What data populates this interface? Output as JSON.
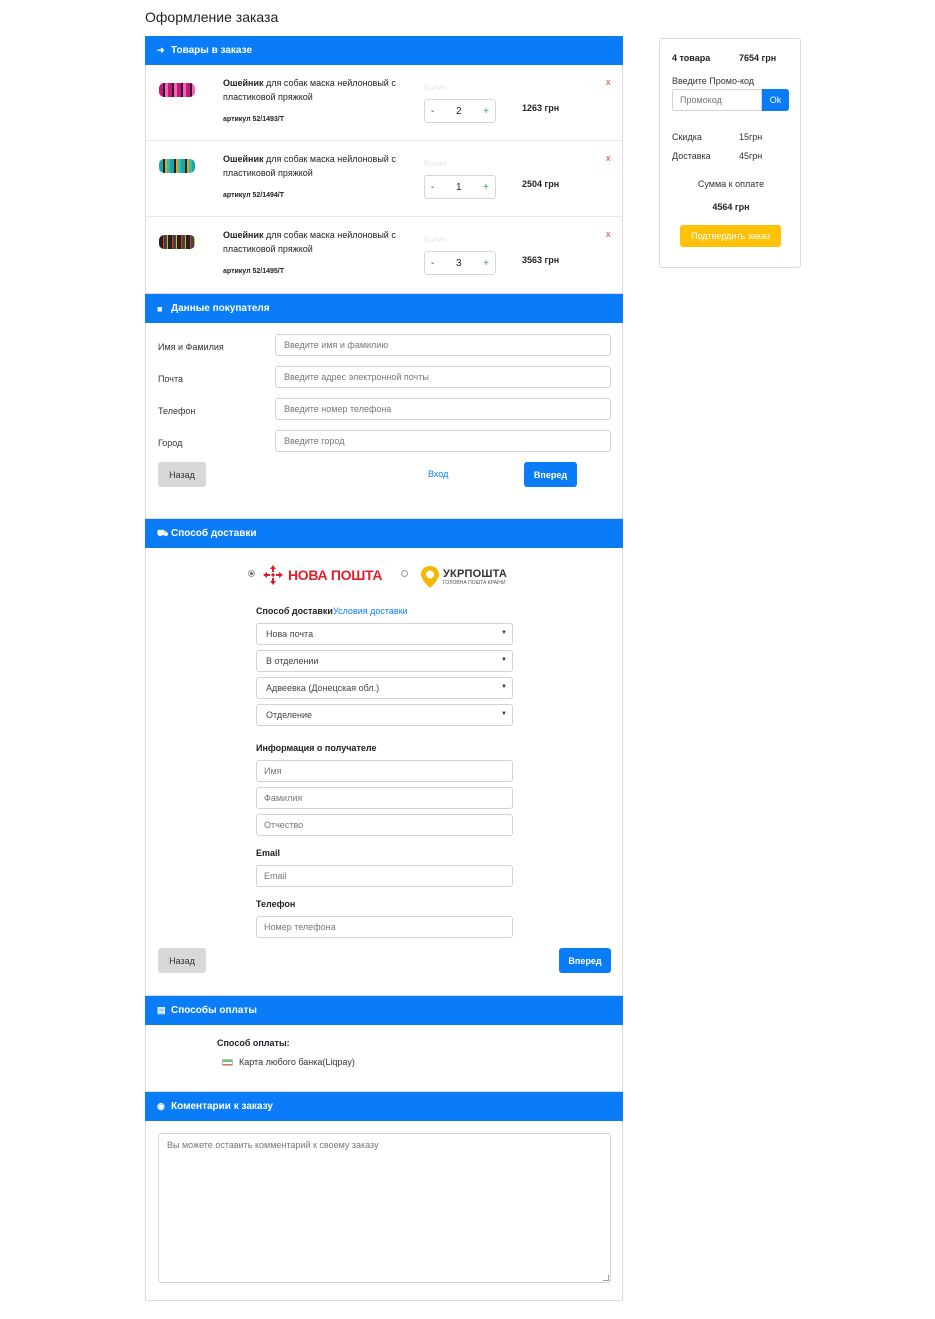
{
  "page": {
    "title": "Оформление заказа"
  },
  "colors": {
    "primary": "#0a7cf7",
    "accent": "#ffc107",
    "danger": "#e33333",
    "plus": "#28a745"
  },
  "cart": {
    "heading": "Товары в заказе",
    "heading_icon": "sign-in-icon",
    "qty_label": "Колич",
    "items": [
      {
        "name_bold": "Ошейник",
        "name_rest": " для собак маска нейлоновый с пластиковой пряжкой",
        "sku": "артикул 52/1493/Т",
        "qty": "2",
        "minus": "-",
        "plus": "+",
        "price": "1263 грн",
        "remove": "x"
      },
      {
        "name_bold": "Ошейник",
        "name_rest": " для собак маска нейлоновый с пластиковой пряжкой",
        "sku": "артикул 52/1494/Т",
        "qty": "1",
        "minus": "-",
        "plus": "+",
        "price": "2504 грн",
        "remove": "x"
      },
      {
        "name_bold": "Ошейник",
        "name_rest": " для собак маска нейлоновый с пластиковой пряжкой",
        "sku": "артикул 52/1495/Т",
        "qty": "3",
        "minus": "-",
        "plus": "+",
        "price": "3563 грн",
        "remove": "x"
      }
    ]
  },
  "buyer": {
    "heading": "Данные покупателя",
    "heading_icon": "id-card-icon",
    "fields": [
      {
        "label": "Имя и Фамилия",
        "placeholder": "Введите имя и фамилию"
      },
      {
        "label": "Почта",
        "placeholder": "Введите адрес электронной почты"
      },
      {
        "label": "Телефон",
        "placeholder": "Введите номер телефона"
      },
      {
        "label": "Город",
        "placeholder": "Введите город"
      }
    ],
    "back": "Назад",
    "login": "Вход",
    "next": "Вперед"
  },
  "delivery": {
    "heading": "Способ доставки",
    "heading_icon": "truck-icon",
    "np_logo": "НОВА ПОШТА",
    "up_logo": "УКРПОШТА",
    "up_tagline": "ГОЛОВНА ПОШТА КРАЇНИ",
    "method_label": "Способ доставки",
    "conditions_link": "Условия доставки",
    "selects": [
      "Нова почта",
      "В отделении",
      "Адвеевка (Донецская обл.)",
      "Отделение"
    ],
    "recipient_label": "Информация о получателе",
    "recipient_fields": [
      "Имя",
      "Фамилия",
      "Отчество"
    ],
    "email_label": "Email",
    "email_placeholder": "Email",
    "phone_label": "Телефон",
    "phone_placeholder": "Номер телефона",
    "back": "Назад",
    "next": "Вперед"
  },
  "payment": {
    "heading": "Способы оплаты",
    "heading_icon": "credit-card-icon",
    "label": "Способ оплаты:",
    "option": "Карта любого банка(Liqpay)"
  },
  "comments": {
    "heading": "Коментарии к заказу",
    "heading_icon": "comments-icon",
    "placeholder": "Вы можете оставить комментарий к своему заказу"
  },
  "summary": {
    "count": "4 товара",
    "total": "7654 грн",
    "promo_label": "Введите Промо-код",
    "promo_placeholder": "Промокод",
    "promo_button": "Ok",
    "discount_label": "Скидка",
    "discount_value": "15грн",
    "delivery_label": "Доставка",
    "delivery_value": "45грн",
    "sum_label": "Сумма к оплате",
    "sum_value": "4564 грн",
    "confirm": "Подтвердить заказ"
  }
}
